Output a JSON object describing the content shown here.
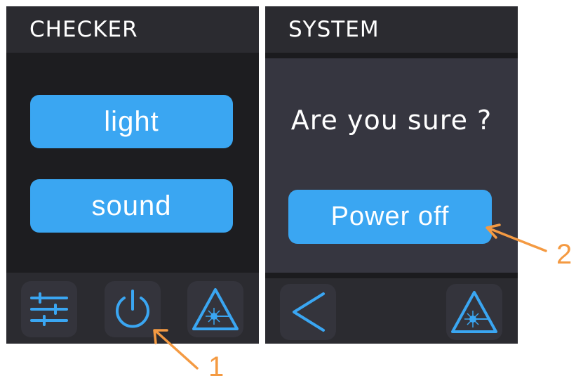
{
  "screens": [
    {
      "title": "CHECKER",
      "buttons": {
        "light": "light",
        "sound": "sound"
      },
      "footer_icons": [
        "sliders-icon",
        "power-icon",
        "laser-warning-icon"
      ]
    },
    {
      "title": "SYSTEM",
      "prompt": "Are you sure ?",
      "buttons": {
        "power_off": "Power off"
      },
      "footer_icons": [
        "back-chevron-icon",
        "laser-warning-icon"
      ]
    }
  ],
  "callouts": [
    "1",
    "2"
  ],
  "colors": {
    "accent": "#3aa6f2",
    "callout": "#f49a42",
    "background": "#232326"
  }
}
